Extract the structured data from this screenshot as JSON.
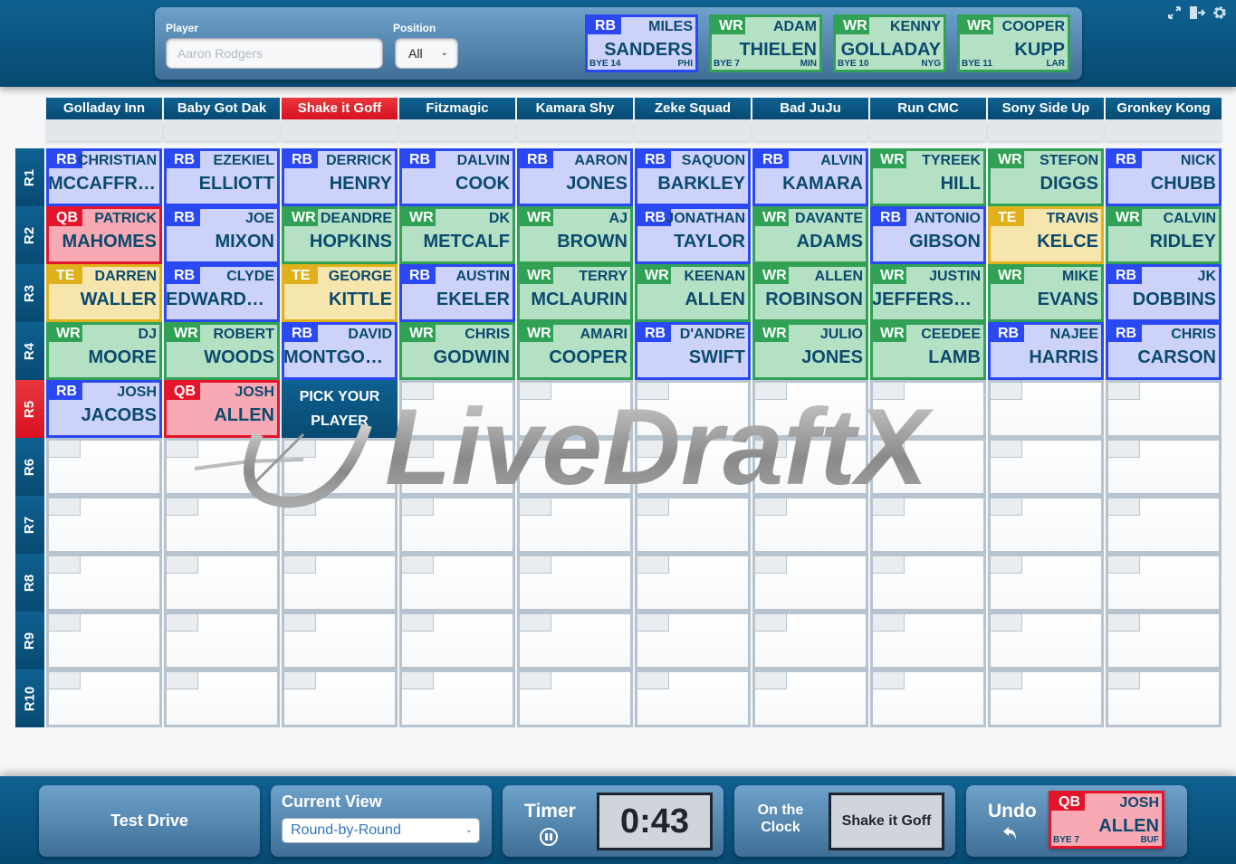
{
  "search": {
    "player_label": "Player",
    "player_placeholder": "Aaron Rodgers",
    "player_value": "",
    "position_label": "Position",
    "position_selected": "All"
  },
  "queue": [
    {
      "pos": "RB",
      "first": "MILES",
      "last": "SANDERS",
      "bye": "BYE 14",
      "team": "PHI"
    },
    {
      "pos": "WR",
      "first": "ADAM",
      "last": "THIELEN",
      "bye": "BYE 7",
      "team": "MIN"
    },
    {
      "pos": "WR",
      "first": "KENNY",
      "last": "GOLLADAY",
      "bye": "BYE 10",
      "team": "NYG"
    },
    {
      "pos": "WR",
      "first": "COOPER",
      "last": "KUPP",
      "bye": "BYE 11",
      "team": "LAR"
    }
  ],
  "top_icons": [
    "fullscreen-icon",
    "exit-icon",
    "settings-icon"
  ],
  "teams": [
    "Golladay Inn",
    "Baby Got Dak",
    "Shake it Goff",
    "Fitzmagic",
    "Kamara Shy",
    "Zeke Squad",
    "Bad JuJu",
    "Run CMC",
    "Sony Side Up",
    "Gronkey Kong"
  ],
  "active_team_index": 2,
  "rounds": [
    "R1",
    "R2",
    "R3",
    "R4",
    "R5",
    "R6",
    "R7",
    "R8",
    "R9",
    "R10"
  ],
  "active_round_index": 4,
  "picks": [
    [
      {
        "pos": "RB",
        "first": "CHRISTIAN",
        "last": "MCCAFFREY"
      },
      {
        "pos": "RB",
        "first": "EZEKIEL",
        "last": "ELLIOTT"
      },
      {
        "pos": "RB",
        "first": "DERRICK",
        "last": "HENRY"
      },
      {
        "pos": "RB",
        "first": "DALVIN",
        "last": "COOK"
      },
      {
        "pos": "RB",
        "first": "AARON",
        "last": "JONES"
      },
      {
        "pos": "RB",
        "first": "SAQUON",
        "last": "BARKLEY"
      },
      {
        "pos": "RB",
        "first": "ALVIN",
        "last": "KAMARA"
      },
      {
        "pos": "WR",
        "first": "TYREEK",
        "last": "HILL"
      },
      {
        "pos": "WR",
        "first": "STEFON",
        "last": "DIGGS"
      },
      {
        "pos": "RB",
        "first": "NICK",
        "last": "CHUBB"
      }
    ],
    [
      {
        "pos": "QB",
        "first": "PATRICK",
        "last": "MAHOMES"
      },
      {
        "pos": "RB",
        "first": "JOE",
        "last": "MIXON"
      },
      {
        "pos": "WR",
        "first": "DEANDRE",
        "last": "HOPKINS"
      },
      {
        "pos": "WR",
        "first": "DK",
        "last": "METCALF"
      },
      {
        "pos": "WR",
        "first": "AJ",
        "last": "BROWN"
      },
      {
        "pos": "RB",
        "first": "JONATHAN",
        "last": "TAYLOR"
      },
      {
        "pos": "WR",
        "first": "DAVANTE",
        "last": "ADAMS"
      },
      {
        "pos": "RB",
        "first": "ANTONIO",
        "last": "GIBSON"
      },
      {
        "pos": "TE",
        "first": "TRAVIS",
        "last": "KELCE"
      },
      {
        "pos": "WR",
        "first": "CALVIN",
        "last": "RIDLEY"
      }
    ],
    [
      {
        "pos": "TE",
        "first": "DARREN",
        "last": "WALLER"
      },
      {
        "pos": "RB",
        "first": "CLYDE",
        "last": "EDWARDS-H..."
      },
      {
        "pos": "TE",
        "first": "GEORGE",
        "last": "KITTLE"
      },
      {
        "pos": "RB",
        "first": "AUSTIN",
        "last": "EKELER"
      },
      {
        "pos": "WR",
        "first": "TERRY",
        "last": "MCLAURIN"
      },
      {
        "pos": "WR",
        "first": "KEENAN",
        "last": "ALLEN"
      },
      {
        "pos": "WR",
        "first": "ALLEN",
        "last": "ROBINSON"
      },
      {
        "pos": "WR",
        "first": "JUSTIN",
        "last": "JEFFERSON"
      },
      {
        "pos": "WR",
        "first": "MIKE",
        "last": "EVANS"
      },
      {
        "pos": "RB",
        "first": "JK",
        "last": "DOBBINS"
      }
    ],
    [
      {
        "pos": "WR",
        "first": "DJ",
        "last": "MOORE"
      },
      {
        "pos": "WR",
        "first": "ROBERT",
        "last": "WOODS"
      },
      {
        "pos": "RB",
        "first": "DAVID",
        "last": "MONTGOME..."
      },
      {
        "pos": "WR",
        "first": "CHRIS",
        "last": "GODWIN"
      },
      {
        "pos": "WR",
        "first": "AMARI",
        "last": "COOPER"
      },
      {
        "pos": "RB",
        "first": "D'ANDRE",
        "last": "SWIFT"
      },
      {
        "pos": "WR",
        "first": "JULIO",
        "last": "JONES"
      },
      {
        "pos": "WR",
        "first": "CEEDEE",
        "last": "LAMB"
      },
      {
        "pos": "RB",
        "first": "NAJEE",
        "last": "HARRIS"
      },
      {
        "pos": "RB",
        "first": "CHRIS",
        "last": "CARSON"
      }
    ],
    [
      {
        "pos": "RB",
        "first": "JOSH",
        "last": "JACOBS"
      },
      {
        "pos": "QB",
        "first": "JOSH",
        "last": "ALLEN"
      }
    ]
  ],
  "pick_prompt": {
    "line1": "PICK YOUR",
    "line2": "PLAYER"
  },
  "watermark_text": "LiveDraftX",
  "bottom": {
    "test_drive_label": "Test Drive",
    "current_view_label": "Current View",
    "current_view_selected": "Round-by-Round",
    "timer_label": "Timer",
    "timer_value": "0:43",
    "on_clock_label_1": "On the",
    "on_clock_label_2": "Clock",
    "on_clock_team": "Shake it Goff",
    "undo_label": "Undo",
    "last_pick": {
      "pos": "QB",
      "first": "JOSH",
      "last": "ALLEN",
      "bye": "BYE 7",
      "team": "BUF"
    }
  },
  "position_colors": {
    "RB": "#2b48f5",
    "WR": "#31a155",
    "QB": "#e3152b",
    "TE": "#e0b11a"
  }
}
